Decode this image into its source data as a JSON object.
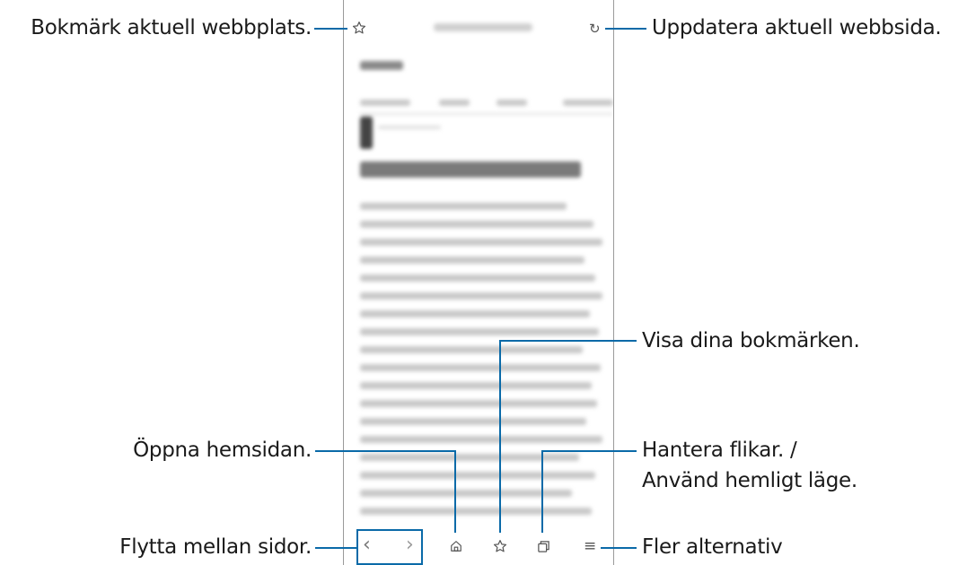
{
  "callouts": {
    "bookmark_site": "Bokmärk aktuell webbplats.",
    "refresh_page": "Uppdatera aktuell webbsida.",
    "show_bookmarks": "Visa dina bokmärken.",
    "open_home": "Öppna hemsidan.",
    "manage_tabs_line1": "Hantera flikar. /",
    "manage_tabs_line2": "Använd hemligt läge.",
    "move_between_pages": "Flytta mellan sidor.",
    "more_options": "Fler alternativ"
  },
  "browser": {
    "back_glyph": "‹",
    "forward_glyph": "›",
    "menu_glyph": "≡",
    "refresh_glyph": "↻",
    "icons": [
      "star-outline-icon",
      "refresh-icon",
      "back-icon",
      "forward-icon",
      "home-icon",
      "bookmarks-icon",
      "tabs-icon",
      "menu-icon"
    ]
  },
  "colors": {
    "callout_line": "#0a6aa8",
    "text": "#1a1a1a",
    "phone_border": "#9a9a9a"
  }
}
